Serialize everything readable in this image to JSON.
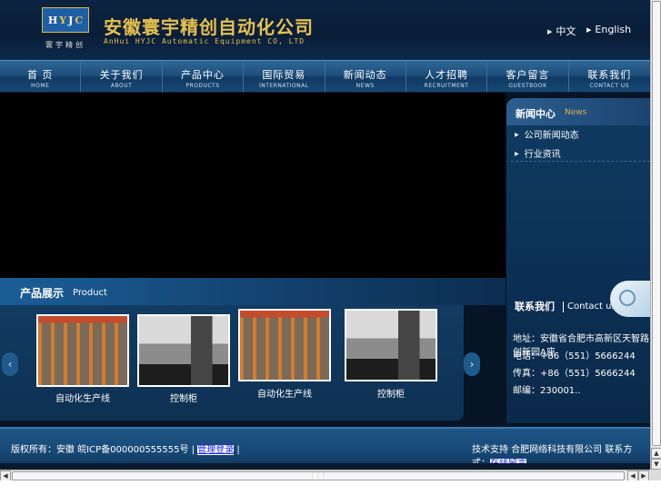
{
  "header": {
    "logo_letters": [
      "H",
      "Y",
      "J",
      "C"
    ],
    "logo_sub": "寰宇精创",
    "company_cn": "安徽寰宇精创自动化公司",
    "company_en": "AnHui HYJC Automatic Equipment CO, LTD",
    "lang_cn": "中文",
    "lang_en": "English",
    "brand_color": "#e6c04e"
  },
  "nav": [
    {
      "cn": "首 页",
      "en": "HOME"
    },
    {
      "cn": "关于我们",
      "en": "ABOUT"
    },
    {
      "cn": "产品中心",
      "en": "PRODUCTS"
    },
    {
      "cn": "国际贸易",
      "en": "INTERNATIONAL"
    },
    {
      "cn": "新闻动态",
      "en": "NEWS"
    },
    {
      "cn": "人才招聘",
      "en": "RECRUITMENT"
    },
    {
      "cn": "客户留言",
      "en": "GUESTBOOK"
    },
    {
      "cn": "联系我们",
      "en": "CONTACT US"
    }
  ],
  "product": {
    "title_cn": "产品展示",
    "title_en": "Product",
    "items": [
      {
        "label": "自动化生产线",
        "icon": "factory-line-photo"
      },
      {
        "label": "控制柜",
        "icon": "control-cabinet-photo"
      },
      {
        "label": "自动化生产线",
        "icon": "factory-line-photo"
      },
      {
        "label": "控制柜",
        "icon": "control-cabinet-photo"
      }
    ],
    "prev_arrow": "‹",
    "next_arrow": "›"
  },
  "news": {
    "title_cn": "新闻中心",
    "title_en": "News",
    "items": [
      "公司新闻动态",
      "行业资讯"
    ]
  },
  "contact": {
    "title_cn": "联系我们",
    "title_en": "Contact us",
    "address": "地址：安徽省合肥市高新区天智路 创新园A座",
    "phone": "电话：+86（551）5666244",
    "fax": "传真：+86（551）5666244",
    "zip": "邮编：230001.."
  },
  "footer": {
    "left_text": "版权所有：安徽 皖ICP备000000555555号 |",
    "left_link": "管理登录",
    "left_end": "|",
    "right_text": "技术支持 合肥网络科技有限公司 联系方式：",
    "right_link": "在线留言"
  }
}
